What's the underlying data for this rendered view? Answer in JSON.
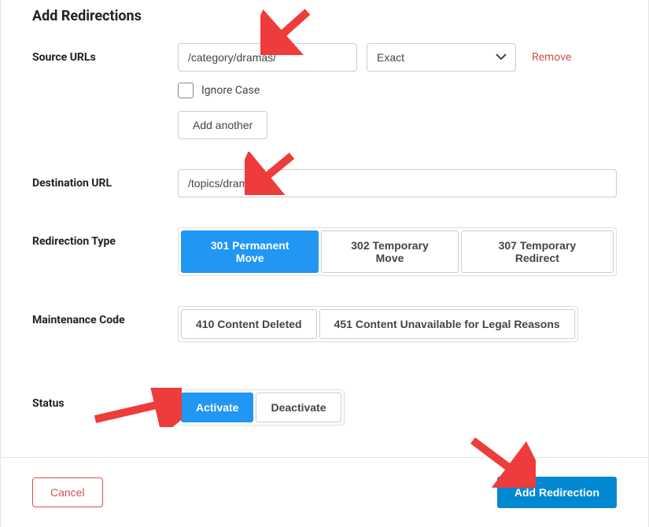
{
  "title": "Add Redirections",
  "labels": {
    "sourceUrls": "Source URLs",
    "destinationUrl": "Destination URL",
    "redirectionType": "Redirection Type",
    "maintenanceCode": "Maintenance Code",
    "status": "Status"
  },
  "source": {
    "value": "/category/dramas/",
    "matchOptions": [
      "Exact"
    ],
    "matchSelected": "Exact",
    "removeLabel": "Remove",
    "ignoreCaseLabel": "Ignore Case",
    "addAnotherLabel": "Add another"
  },
  "destination": {
    "value": "/topics/dramas/"
  },
  "redirectionType": {
    "options": [
      "301 Permanent Move",
      "302 Temporary Move",
      "307 Temporary Redirect"
    ],
    "selected": "301 Permanent Move"
  },
  "maintenanceCode": {
    "options": [
      "410 Content Deleted",
      "451 Content Unavailable for Legal Reasons"
    ]
  },
  "status": {
    "options": [
      "Activate",
      "Deactivate"
    ],
    "selected": "Activate"
  },
  "footer": {
    "cancelLabel": "Cancel",
    "submitLabel": "Add Redirection"
  }
}
